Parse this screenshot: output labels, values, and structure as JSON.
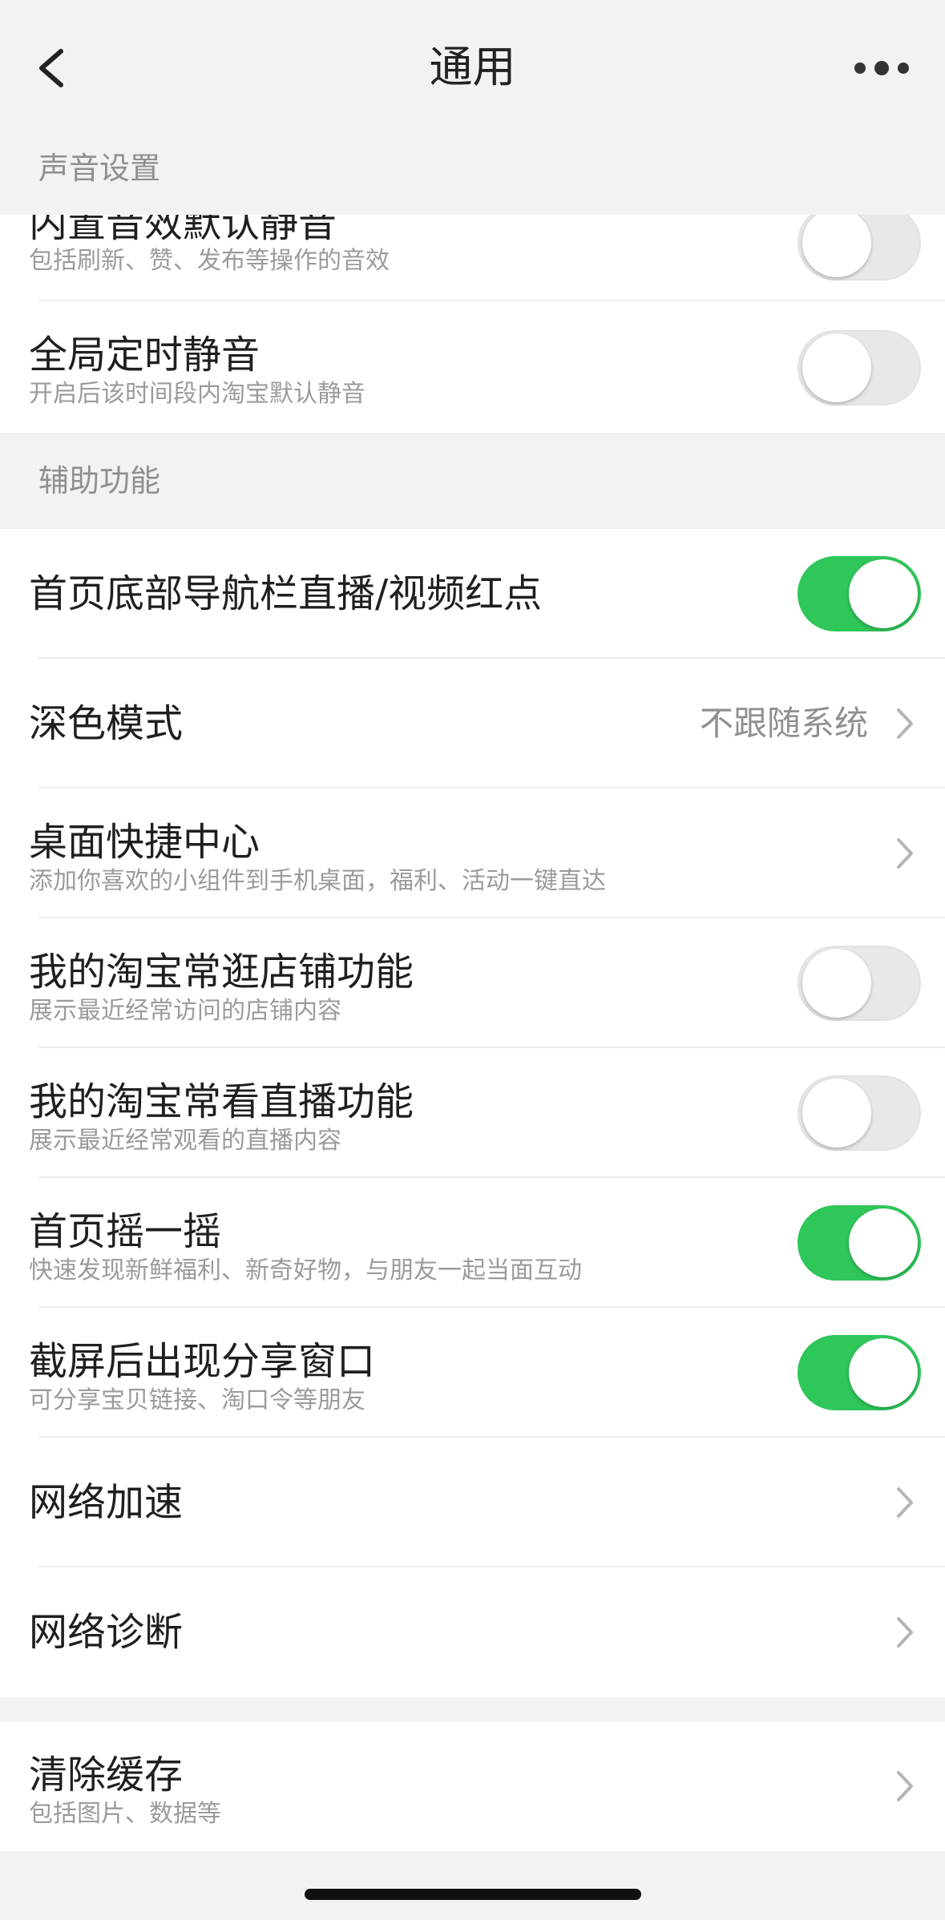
{
  "header": {
    "title": "通用"
  },
  "sections": {
    "sound": {
      "label": "声音设置"
    },
    "accessibility": {
      "label": "辅助功能"
    }
  },
  "rows": {
    "builtin_mute": {
      "title": "内置音效默认静音",
      "subtitle": "包括刷新、赞、发布等操作的音效",
      "toggle": "off"
    },
    "scheduled_mute": {
      "title": "全局定时静音",
      "subtitle": "开启后该时间段内淘宝默认静音",
      "toggle": "off"
    },
    "nav_red_dot": {
      "title": "首页底部导航栏直播/视频红点",
      "toggle": "on"
    },
    "dark_mode": {
      "title": "深色模式",
      "value": "不跟随系统"
    },
    "desktop_center": {
      "title": "桌面快捷中心",
      "subtitle": "添加你喜欢的小组件到手机桌面，福利、活动一键直达"
    },
    "frequent_shops": {
      "title": "我的淘宝常逛店铺功能",
      "subtitle": "展示最近经常访问的店铺内容",
      "toggle": "off"
    },
    "frequent_live": {
      "title": "我的淘宝常看直播功能",
      "subtitle": "展示最近经常观看的直播内容",
      "toggle": "off"
    },
    "shake": {
      "title": "首页摇一摇",
      "subtitle": "快速发现新鲜福利、新奇好物，与朋友一起当面互动",
      "toggle": "on"
    },
    "screenshot_share": {
      "title": "截屏后出现分享窗口",
      "subtitle": "可分享宝贝链接、淘口令等朋友",
      "toggle": "on"
    },
    "network_speedup": {
      "title": "网络加速"
    },
    "network_diagnose": {
      "title": "网络诊断"
    },
    "clear_cache": {
      "title": "清除缓存",
      "subtitle": "包括图片、数据等"
    }
  },
  "colors": {
    "toggle_on": "#2fc65a",
    "toggle_off": "#e8e8e8",
    "background": "#f2f2f2"
  }
}
